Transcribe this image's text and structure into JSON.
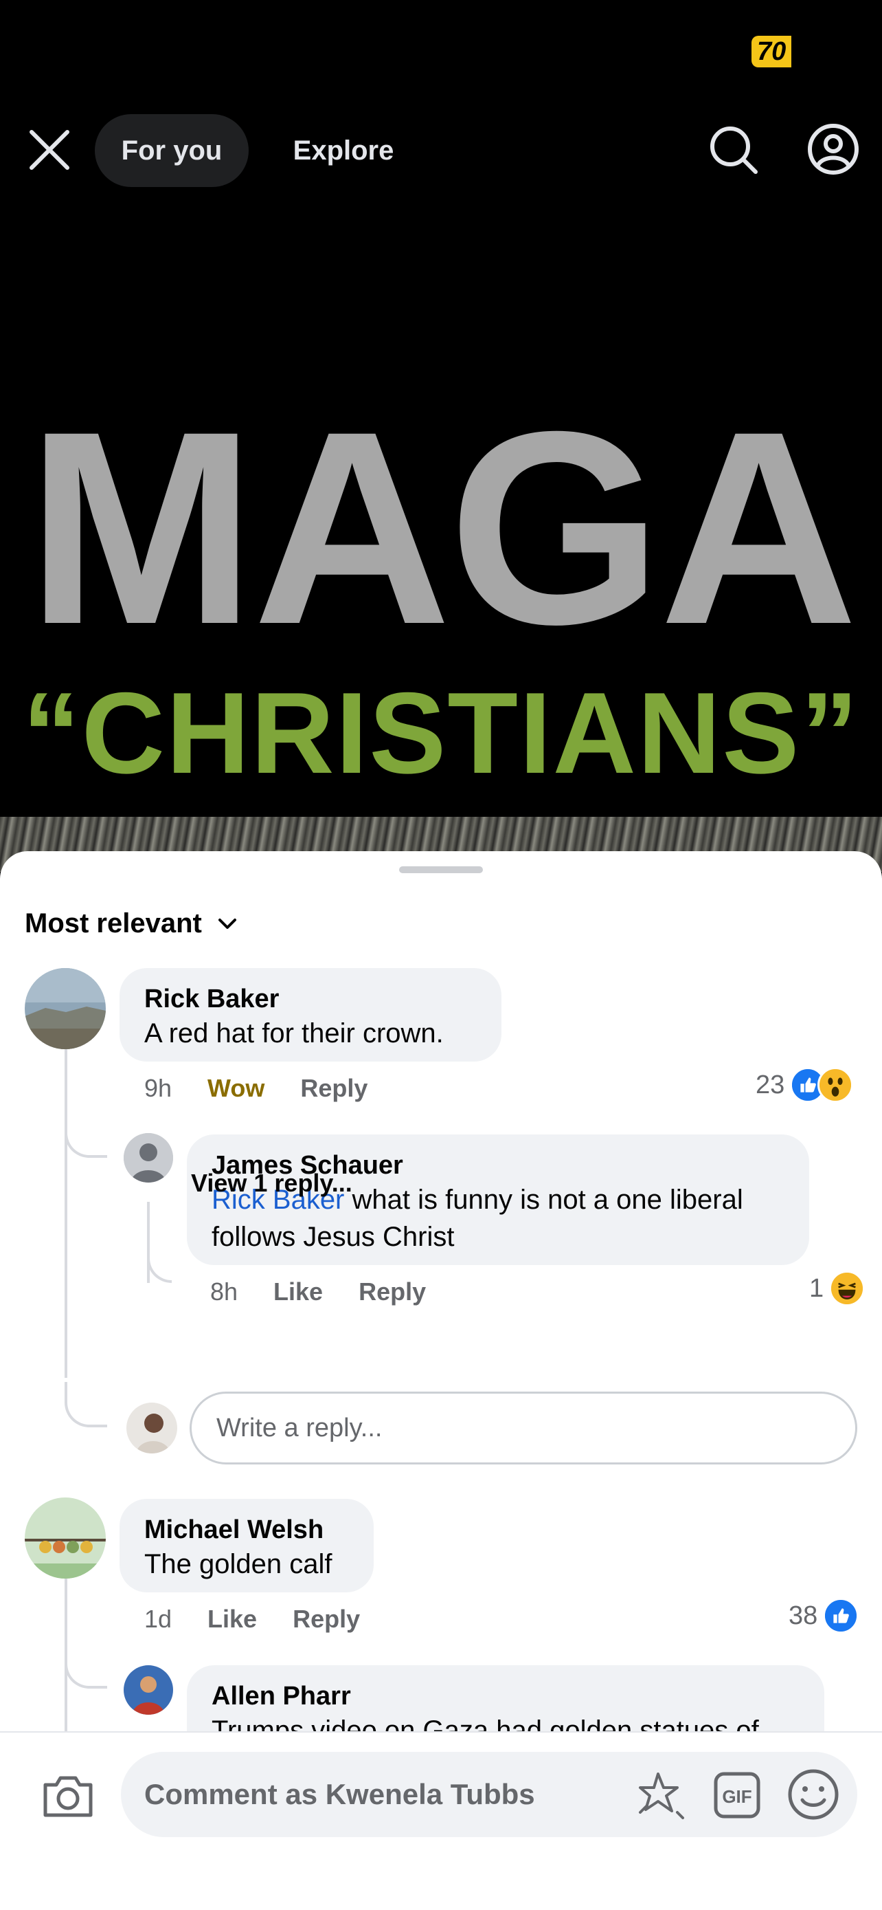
{
  "status": {
    "battery": "70"
  },
  "nav": {
    "tab_for_you": "For you",
    "tab_explore": "Explore"
  },
  "post": {
    "headline_line1": "MAGA",
    "headline_line2": "“CHRISTIANS”"
  },
  "comments": {
    "sort_label": "Most relevant",
    "items": [
      {
        "author": "Rick Baker",
        "text": "A red hat for their crown.",
        "time": "9h",
        "reaction_action": "Wow",
        "reply_label": "Reply",
        "reaction_count": "23",
        "replies": [
          {
            "author": "James Schauer",
            "mention": "Rick Baker",
            "text": " what is funny is not a one liberal follows Jesus Christ",
            "time": "8h",
            "like_label": "Like",
            "reply_label": "Reply",
            "reaction_count": "1"
          }
        ],
        "view_replies": "View 1 reply...",
        "reply_placeholder": "Write a reply..."
      },
      {
        "author": "Michael Welsh",
        "text": "The golden calf",
        "time": "1d",
        "like_label": "Like",
        "reply_label": "Reply",
        "reaction_count": "38",
        "replies": [
          {
            "author": "Allen Pharr",
            "text": "Trumps video on Gaza had golden statues of"
          }
        ]
      }
    ]
  },
  "composer": {
    "placeholder": "Comment as Kwenela Tubbs"
  },
  "colors": {
    "accent_blue": "#1877f2",
    "wow_yellow": "#8a6d00",
    "headline_green": "#7fa63a"
  },
  "icons": [
    "close-icon",
    "search-icon",
    "profile-icon",
    "chevron-down-icon",
    "like-reaction-icon",
    "wow-reaction-icon",
    "haha-reaction-icon",
    "camera-icon",
    "avatar-sticker-icon",
    "gif-icon",
    "emoji-icon"
  ]
}
